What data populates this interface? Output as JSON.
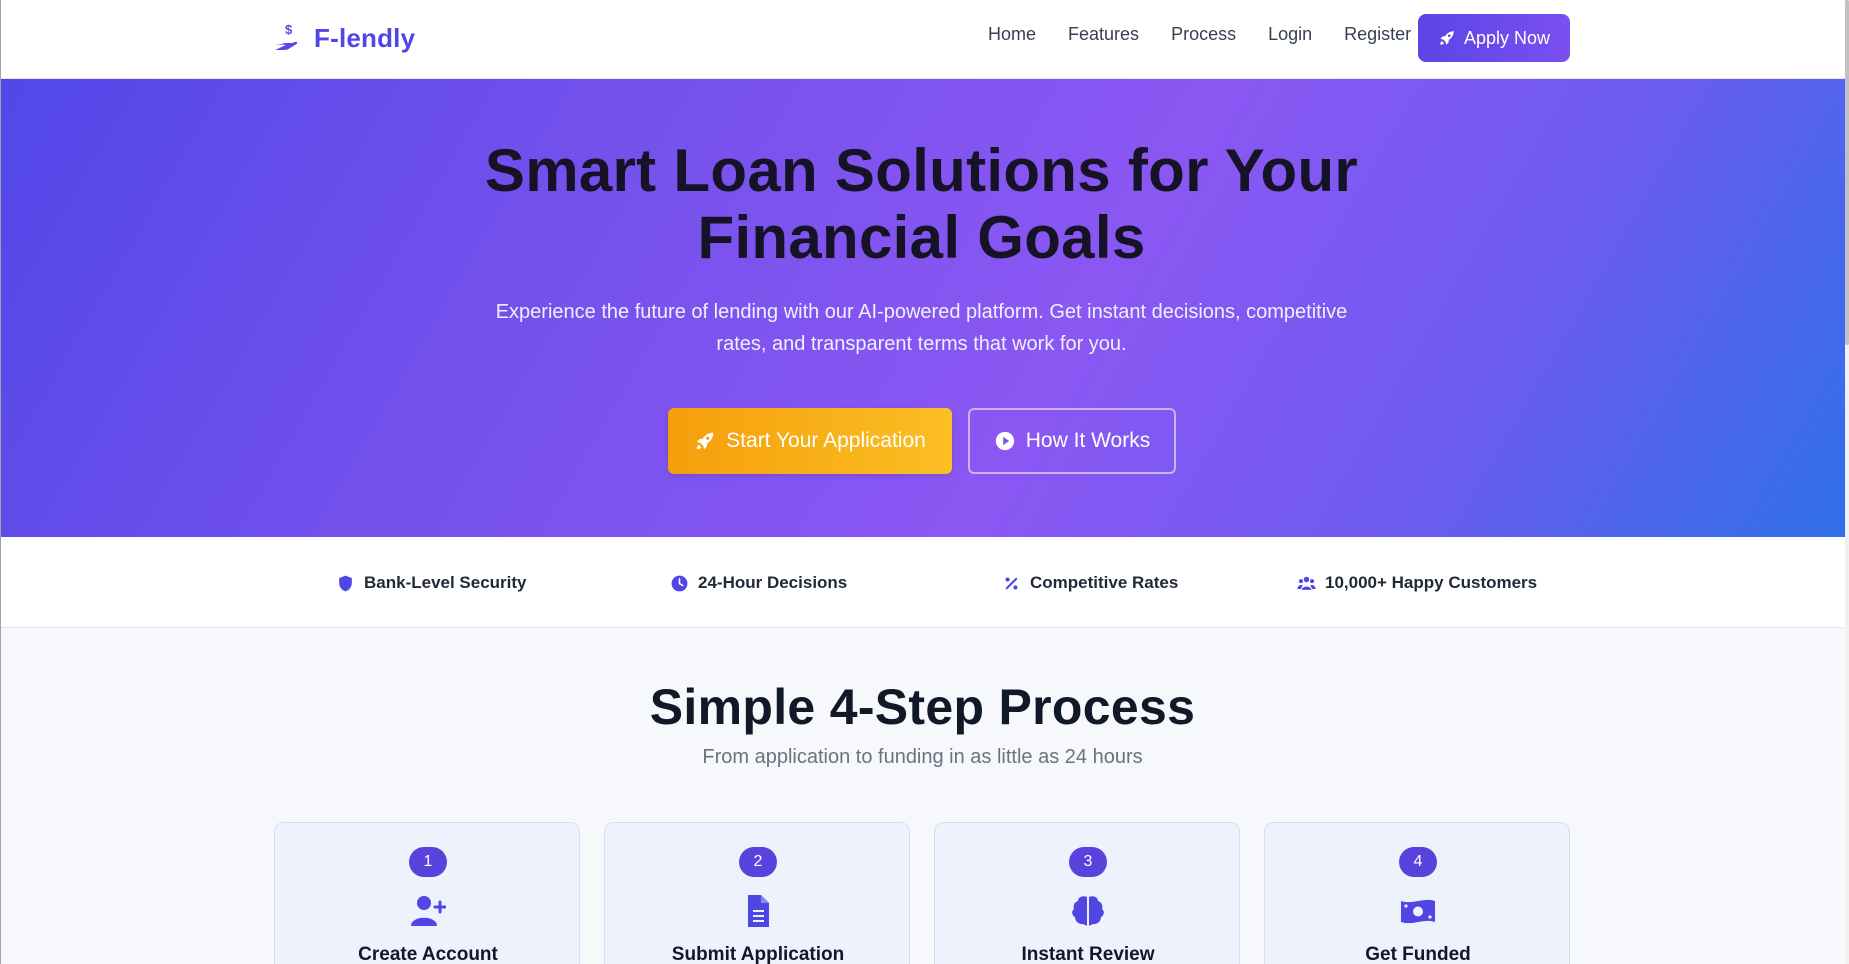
{
  "brand": {
    "name": "F-lendly",
    "logo_icon": "hand-holding-dollar-icon",
    "accent": "#4f46e5"
  },
  "nav": {
    "links": [
      "Home",
      "Features",
      "Process",
      "Login",
      "Register"
    ],
    "cta_label": "Apply Now",
    "cta_icon": "rocket-icon"
  },
  "hero": {
    "title": "Smart Loan Solutions for Your Financial Goals",
    "subtitle": "Experience the future of lending with our AI-powered platform. Get instant decisions, competitive rates, and transparent terms that work for you.",
    "primary_button": "Start Your Application",
    "primary_icon": "rocket-icon",
    "secondary_button": "How It Works",
    "secondary_icon": "play-circle-icon",
    "gradient": [
      "#5147e8",
      "#8b57f3",
      "#2f6fea"
    ],
    "primary_color": "#f59e0b"
  },
  "trust": [
    {
      "label": "Bank-Level Security",
      "icon": "shield-icon"
    },
    {
      "label": "24-Hour Decisions",
      "icon": "clock-icon"
    },
    {
      "label": "Competitive Rates",
      "icon": "percent-icon"
    },
    {
      "label": "10,000+ Happy Customers",
      "icon": "users-icon"
    }
  ],
  "process": {
    "title": "Simple 4-Step Process",
    "subtitle": "From application to funding in as little as 24 hours",
    "steps": [
      {
        "number": "1",
        "title": "Create Account",
        "icon": "user-plus-icon"
      },
      {
        "number": "2",
        "title": "Submit Application",
        "icon": "file-text-icon"
      },
      {
        "number": "3",
        "title": "Instant Review",
        "icon": "brain-icon"
      },
      {
        "number": "4",
        "title": "Get Funded",
        "icon": "money-bill-icon"
      }
    ]
  }
}
